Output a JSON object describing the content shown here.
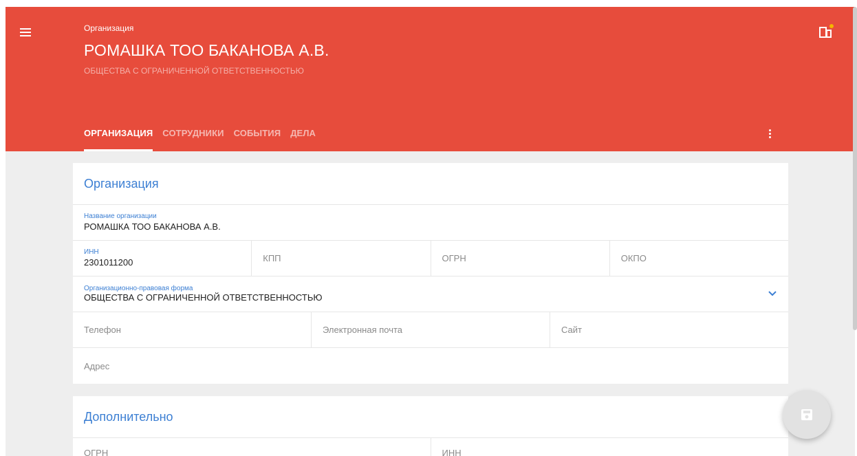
{
  "header": {
    "breadcrumb": "Организация",
    "title": "РОМАШКА ТОО БАКАНОВА А.В.",
    "subtitle": "ОБЩЕСТВА С ОГРАНИЧЕННОЙ ОТВЕТСТВЕННОСТЬЮ",
    "menu_icon": "hamburger-menu-icon",
    "corner_icon": "org-switch-icon",
    "more_icon": "more-vert-icon",
    "accent_color": "#e74c3c"
  },
  "tabs": [
    {
      "label": "ОРГАНИЗАЦИЯ",
      "active": true
    },
    {
      "label": "СОТРУДНИКИ",
      "active": false
    },
    {
      "label": "СОБЫТИЯ",
      "active": false
    },
    {
      "label": "ДЕЛА",
      "active": false
    }
  ],
  "organization": {
    "section_title": "Организация",
    "name_label": "Название организации",
    "name_value": "РОМАШКА ТОО БАКАНОВА А.В.",
    "inn_label": "ИНН",
    "inn_value": "2301011200",
    "kpp_placeholder": "КПП",
    "ogrn_placeholder": "ОГРН",
    "okpo_placeholder": "ОКПО",
    "legal_form_label": "Организационно-правовая форма",
    "legal_form_value": "ОБЩЕСТВА С ОГРАНИЧЕННОЙ ОТВЕТСТВЕННОСТЬЮ",
    "phone_placeholder": "Телефон",
    "email_placeholder": "Электронная почта",
    "site_placeholder": "Сайт",
    "address_placeholder": "Адрес"
  },
  "additional": {
    "section_title": "Дополнительно",
    "ogrn_placeholder": "ОГРН",
    "inn_placeholder": "ИНН"
  },
  "fab": {
    "icon": "save-icon"
  }
}
